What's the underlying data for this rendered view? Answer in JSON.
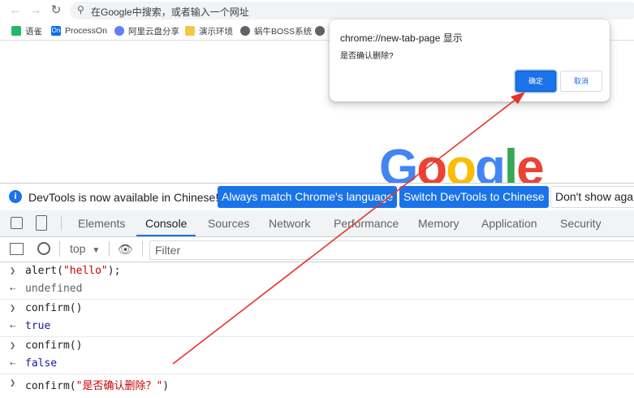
{
  "browser": {
    "address_placeholder": "在Google中搜索，或者输入一个网址",
    "bookmarks": [
      {
        "label": "语雀",
        "icon": "yuque-icon",
        "color": "#25b864"
      },
      {
        "label": "ProcessOn",
        "icon": "processon-icon",
        "color": "#0b6ef6"
      },
      {
        "label": "阿里云盘分享",
        "icon": "aliyun-drive-icon",
        "color": "#637dff"
      },
      {
        "label": "演示环境",
        "icon": "folder-icon",
        "color": "#f6c744"
      },
      {
        "label": "蜗牛BOSS系统",
        "icon": "globe-icon",
        "color": "#5f6368"
      }
    ]
  },
  "page": {
    "logo_text": "Google"
  },
  "dialog": {
    "title": "chrome://new-tab-page 显示",
    "message": "是否确认删除?",
    "ok_label": "确定",
    "cancel_label": "取消"
  },
  "devtools": {
    "info_text": "DevTools is now available in Chinese!",
    "btn_match": "Always match Chrome's language",
    "btn_switch": "Switch DevTools to Chinese",
    "btn_dont_show": "Don't show again",
    "tabs": [
      "Elements",
      "Console",
      "Sources",
      "Network",
      "Performance",
      "Memory",
      "Application",
      "Security"
    ],
    "active_tab": "Console",
    "context": "top",
    "filter_placeholder": "Filter",
    "console_lines": [
      {
        "type": "input",
        "text_pre": "alert(",
        "text_str": "\"hello\"",
        "text_post": ");"
      },
      {
        "type": "output",
        "text": "undefined"
      },
      {
        "type": "input",
        "text_pre": "confirm()",
        "text_str": "",
        "text_post": ""
      },
      {
        "type": "output",
        "text": "true"
      },
      {
        "type": "input",
        "text_pre": "confirm()",
        "text_str": "",
        "text_post": ""
      },
      {
        "type": "output",
        "text": "false"
      },
      {
        "type": "input",
        "text_pre": "confirm(",
        "text_str": "\"是否确认删除？\"",
        "text_post": ")"
      }
    ]
  },
  "colors": {
    "accent": "#1a73e8",
    "annotation_arrow": "#e8322a"
  }
}
